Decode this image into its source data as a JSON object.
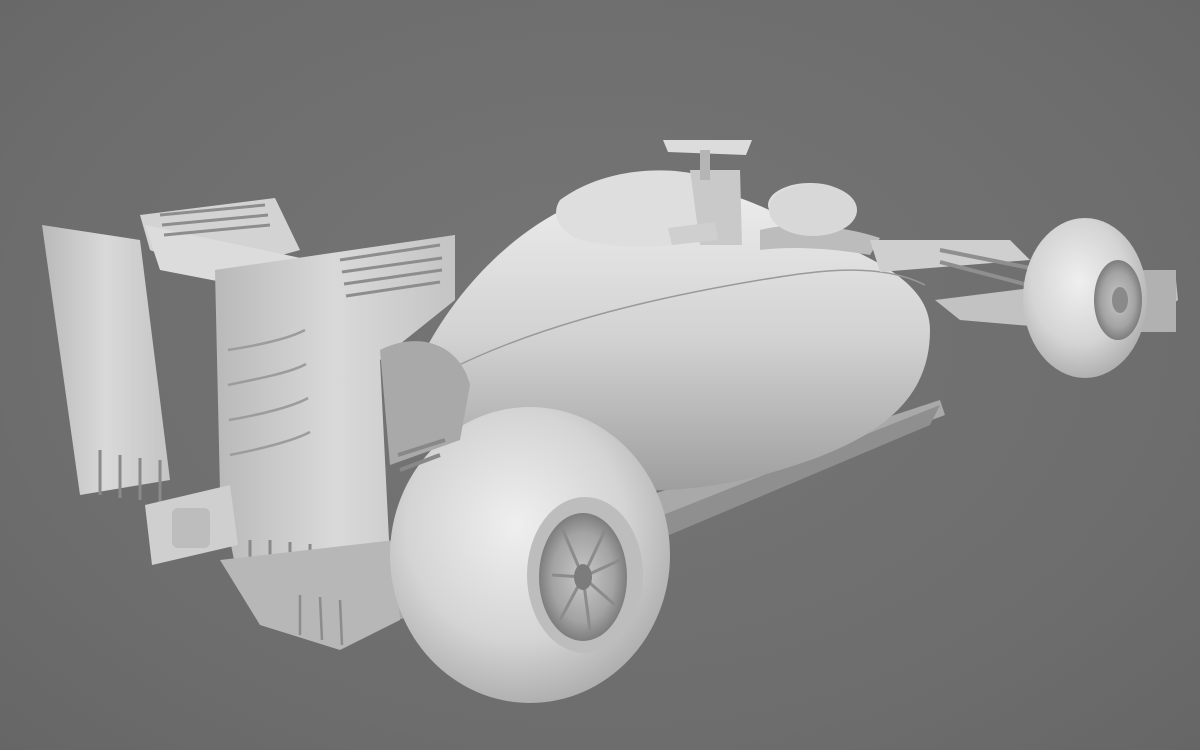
{
  "scene": {
    "subject": "f1-car-clay-render",
    "colors": {
      "background": "#6f6f6f",
      "clay_light": "#e6e6e6",
      "clay_mid": "#bdbdbd",
      "clay_dark": "#8c8c8c",
      "shadow": "#5a5a5a"
    }
  }
}
